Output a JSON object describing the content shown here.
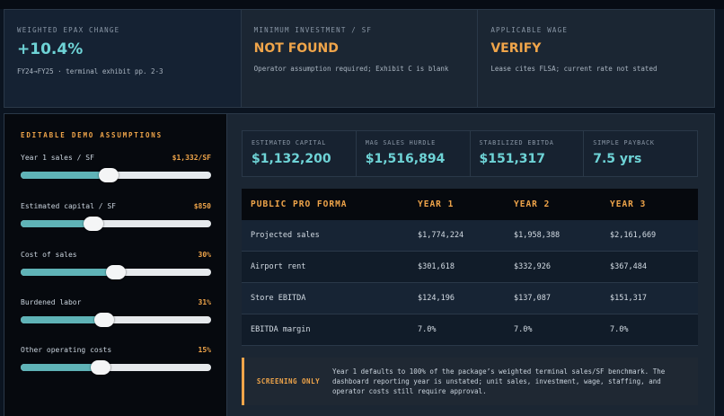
{
  "kpis": [
    {
      "label": "Weighted EPAX change",
      "value": "+10.4%",
      "note": "FY24→FY25 · terminal exhibit pp. 2-3"
    },
    {
      "label": "Minimum investment / SF",
      "value": "NOT FOUND",
      "note": "Operator assumption required; Exhibit C is blank"
    },
    {
      "label": "Applicable wage",
      "value": "VERIFY",
      "note": "Lease cites FLSA; current rate not stated"
    }
  ],
  "assumptions": {
    "title": "EDITABLE DEMO ASSUMPTIONS",
    "sliders": [
      {
        "label": "Year 1 sales / SF",
        "value": "$1,332/SF",
        "level": 0.46
      },
      {
        "label": "Estimated capital / SF",
        "value": "$850",
        "level": 0.38
      },
      {
        "label": "Cost of sales",
        "value": "30%",
        "level": 0.5
      },
      {
        "label": "Burdened labor",
        "value": "31%",
        "level": 0.44
      },
      {
        "label": "Other operating costs",
        "value": "15%",
        "level": 0.42
      }
    ]
  },
  "metrics": [
    {
      "label": "Estimated capital",
      "value": "$1,132,200"
    },
    {
      "label": "MAG sales hurdle",
      "value": "$1,516,894"
    },
    {
      "label": "Stabilized EBITDA",
      "value": "$151,317"
    },
    {
      "label": "Simple payback",
      "value": "7.5 yrs"
    }
  ],
  "proforma": {
    "headers": [
      "PUBLIC PRO FORMA",
      "YEAR 1",
      "YEAR 2",
      "YEAR 3"
    ],
    "rows": [
      [
        "Projected sales",
        "$1,774,224",
        "$1,958,388",
        "$2,161,669"
      ],
      [
        "Airport rent",
        "$301,618",
        "$332,926",
        "$367,484"
      ],
      [
        "Store EBITDA",
        "$124,196",
        "$137,087",
        "$151,317"
      ],
      [
        "EBITDA margin",
        "7.0%",
        "7.0%",
        "7.0%"
      ]
    ]
  },
  "notice": {
    "tag": "SCREENING ONLY",
    "text": "Year 1 defaults to 100% of the package’s weighted terminal sales/SF benchmark. The dashboard reporting year is unstated; unit sales, investment, wage, staffing, and operator costs still require approval."
  }
}
